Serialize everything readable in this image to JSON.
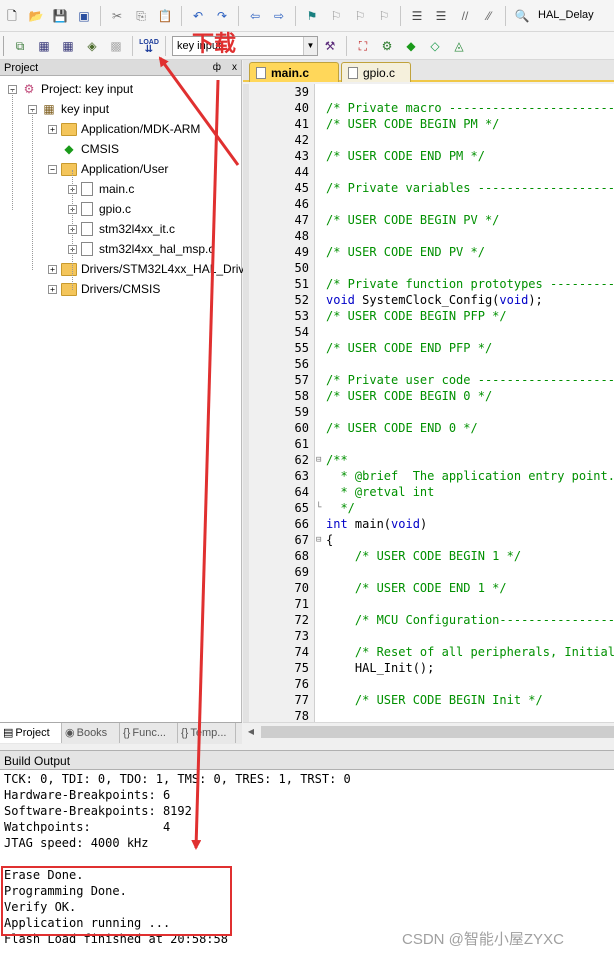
{
  "toolbar": {
    "target_combo": "HAL_Delay",
    "project_combo": "key input",
    "icons": [
      "new-file-icon",
      "open-folder-icon",
      "save-icon",
      "save-all-icon",
      "cut-icon",
      "copy-icon",
      "paste-icon",
      "undo-icon",
      "redo-icon",
      "nav-back-icon",
      "nav-forward-icon",
      "bookmark-icon",
      "prev-bookmark-icon",
      "next-bookmark-icon",
      "clear-bookmarks-icon",
      "indent-icon",
      "unindent-icon",
      "comment-icon",
      "uncomment-icon",
      "find-in-files-icon"
    ]
  },
  "annotation": {
    "label": "下载",
    "watermark": "CSDN @智能小屋ZYXC"
  },
  "project_panel": {
    "title": "Project",
    "pin": "ф",
    "close": "x",
    "tree": [
      {
        "label": "Project: key input",
        "depth": 0,
        "icon": "project-icon",
        "expander": "−"
      },
      {
        "label": "key input",
        "depth": 1,
        "icon": "target-icon",
        "expander": "−"
      },
      {
        "label": "Application/MDK-ARM",
        "depth": 2,
        "icon": "folder-icon",
        "expander": "+"
      },
      {
        "label": "CMSIS",
        "depth": 2,
        "icon": "cmsis-icon",
        "expander": ""
      },
      {
        "label": "Application/User",
        "depth": 2,
        "icon": "folder-icon",
        "expander": "−"
      },
      {
        "label": "main.c",
        "depth": 3,
        "icon": "file-icon",
        "expander": "+"
      },
      {
        "label": "gpio.c",
        "depth": 3,
        "icon": "file-icon",
        "expander": "+"
      },
      {
        "label": "stm32l4xx_it.c",
        "depth": 3,
        "icon": "file-icon",
        "expander": "+"
      },
      {
        "label": "stm32l4xx_hal_msp.c",
        "depth": 3,
        "icon": "file-icon",
        "expander": "+"
      },
      {
        "label": "Drivers/STM32L4xx_HAL_Driver",
        "depth": 2,
        "icon": "folder-icon",
        "expander": "+"
      },
      {
        "label": "Drivers/CMSIS",
        "depth": 2,
        "icon": "folder-icon",
        "expander": "+"
      }
    ],
    "tabs": [
      {
        "label": "Project",
        "icon": "▤"
      },
      {
        "label": "Books",
        "icon": "◉"
      },
      {
        "label": "Func...",
        "icon": "{}"
      },
      {
        "label": "Temp...",
        "icon": "{}"
      }
    ]
  },
  "editor": {
    "tabs": [
      {
        "label": "main.c",
        "active": true
      },
      {
        "label": "gpio.c",
        "active": false
      }
    ],
    "lines": [
      {
        "n": "39",
        "text": "",
        "cls": "c-def",
        "fold": ""
      },
      {
        "n": "40",
        "text": "/* Private macro -----------------------------------",
        "cls": "c-com",
        "fold": ""
      },
      {
        "n": "41",
        "text": "/* USER CODE BEGIN PM */",
        "cls": "c-com",
        "fold": ""
      },
      {
        "n": "42",
        "text": "",
        "cls": "c-def",
        "fold": ""
      },
      {
        "n": "43",
        "text": "/* USER CODE END PM */",
        "cls": "c-com",
        "fold": ""
      },
      {
        "n": "44",
        "text": "",
        "cls": "c-def",
        "fold": ""
      },
      {
        "n": "45",
        "text": "/* Private variables ---------------------------------",
        "cls": "c-com",
        "fold": ""
      },
      {
        "n": "46",
        "text": "",
        "cls": "c-def",
        "fold": ""
      },
      {
        "n": "47",
        "text": "/* USER CODE BEGIN PV */",
        "cls": "c-com",
        "fold": ""
      },
      {
        "n": "48",
        "text": "",
        "cls": "c-def",
        "fold": ""
      },
      {
        "n": "49",
        "text": "/* USER CODE END PV */",
        "cls": "c-com",
        "fold": ""
      },
      {
        "n": "50",
        "text": "",
        "cls": "c-def",
        "fold": ""
      },
      {
        "n": "51",
        "text": "/* Private function prototypes -----------------------",
        "cls": "c-com",
        "fold": ""
      },
      {
        "n": "52",
        "text": "",
        "cls": "c-def",
        "fold": "",
        "html": "<span class=\"c-kw\">void</span> SystemClock_Config(<span class=\"c-kw\">void</span>);"
      },
      {
        "n": "53",
        "text": "/* USER CODE BEGIN PFP */",
        "cls": "c-com",
        "fold": ""
      },
      {
        "n": "54",
        "text": "",
        "cls": "c-def",
        "fold": ""
      },
      {
        "n": "55",
        "text": "/* USER CODE END PFP */",
        "cls": "c-com",
        "fold": ""
      },
      {
        "n": "56",
        "text": "",
        "cls": "c-def",
        "fold": ""
      },
      {
        "n": "57",
        "text": "/* Private user code ---------------------------------",
        "cls": "c-com",
        "fold": ""
      },
      {
        "n": "58",
        "text": "/* USER CODE BEGIN 0 */",
        "cls": "c-com",
        "fold": ""
      },
      {
        "n": "59",
        "text": "",
        "cls": "c-def",
        "fold": ""
      },
      {
        "n": "60",
        "text": "/* USER CODE END 0 */",
        "cls": "c-com",
        "fold": ""
      },
      {
        "n": "61",
        "text": "",
        "cls": "c-def",
        "fold": ""
      },
      {
        "n": "62",
        "text": "/**",
        "cls": "c-com",
        "fold": "⊟"
      },
      {
        "n": "63",
        "text": "  * @brief  The application entry point.",
        "cls": "c-com",
        "fold": ""
      },
      {
        "n": "64",
        "text": "  * @retval int",
        "cls": "c-com",
        "fold": ""
      },
      {
        "n": "65",
        "text": "  */",
        "cls": "c-com",
        "fold": "└"
      },
      {
        "n": "66",
        "text": "",
        "cls": "c-def",
        "fold": "",
        "html": "<span class=\"c-kw\">int</span> main(<span class=\"c-kw\">void</span>)"
      },
      {
        "n": "67",
        "text": "{",
        "cls": "c-def",
        "fold": "⊟"
      },
      {
        "n": "68",
        "text": "    /* USER CODE BEGIN 1 */",
        "cls": "c-com",
        "fold": ""
      },
      {
        "n": "69",
        "text": "",
        "cls": "c-def",
        "fold": ""
      },
      {
        "n": "70",
        "text": "    /* USER CODE END 1 */",
        "cls": "c-com",
        "fold": ""
      },
      {
        "n": "71",
        "text": "",
        "cls": "c-def",
        "fold": ""
      },
      {
        "n": "72",
        "text": "    /* MCU Configuration--------------------------------",
        "cls": "c-com",
        "fold": ""
      },
      {
        "n": "73",
        "text": "",
        "cls": "c-def",
        "fold": ""
      },
      {
        "n": "74",
        "text": "    /* Reset of all peripherals, Initializes the Flash",
        "cls": "c-com",
        "fold": ""
      },
      {
        "n": "75",
        "text": "    HAL_Init();",
        "cls": "c-def",
        "fold": ""
      },
      {
        "n": "76",
        "text": "",
        "cls": "c-def",
        "fold": ""
      },
      {
        "n": "77",
        "text": "    /* USER CODE BEGIN Init */",
        "cls": "c-com",
        "fold": ""
      },
      {
        "n": "78",
        "text": "",
        "cls": "c-def",
        "fold": ""
      }
    ]
  },
  "build_output": {
    "title": "Build Output",
    "lines": [
      "TCK: 0, TDI: 0, TDO: 1, TMS: 0, TRES: 1, TRST: 0",
      "Hardware-Breakpoints: 6",
      "Software-Breakpoints: 8192",
      "Watchpoints:          4",
      "JTAG speed: 4000 kHz",
      "",
      "Erase Done.",
      "Programming Done.",
      "Verify OK.",
      "Application running ...",
      "Flash Load finished at 20:58:58"
    ]
  },
  "colors": {
    "annotation": "#e03030",
    "comment": "#009000",
    "keyword": "#0000c8",
    "active_tab": "#ffd75a"
  }
}
